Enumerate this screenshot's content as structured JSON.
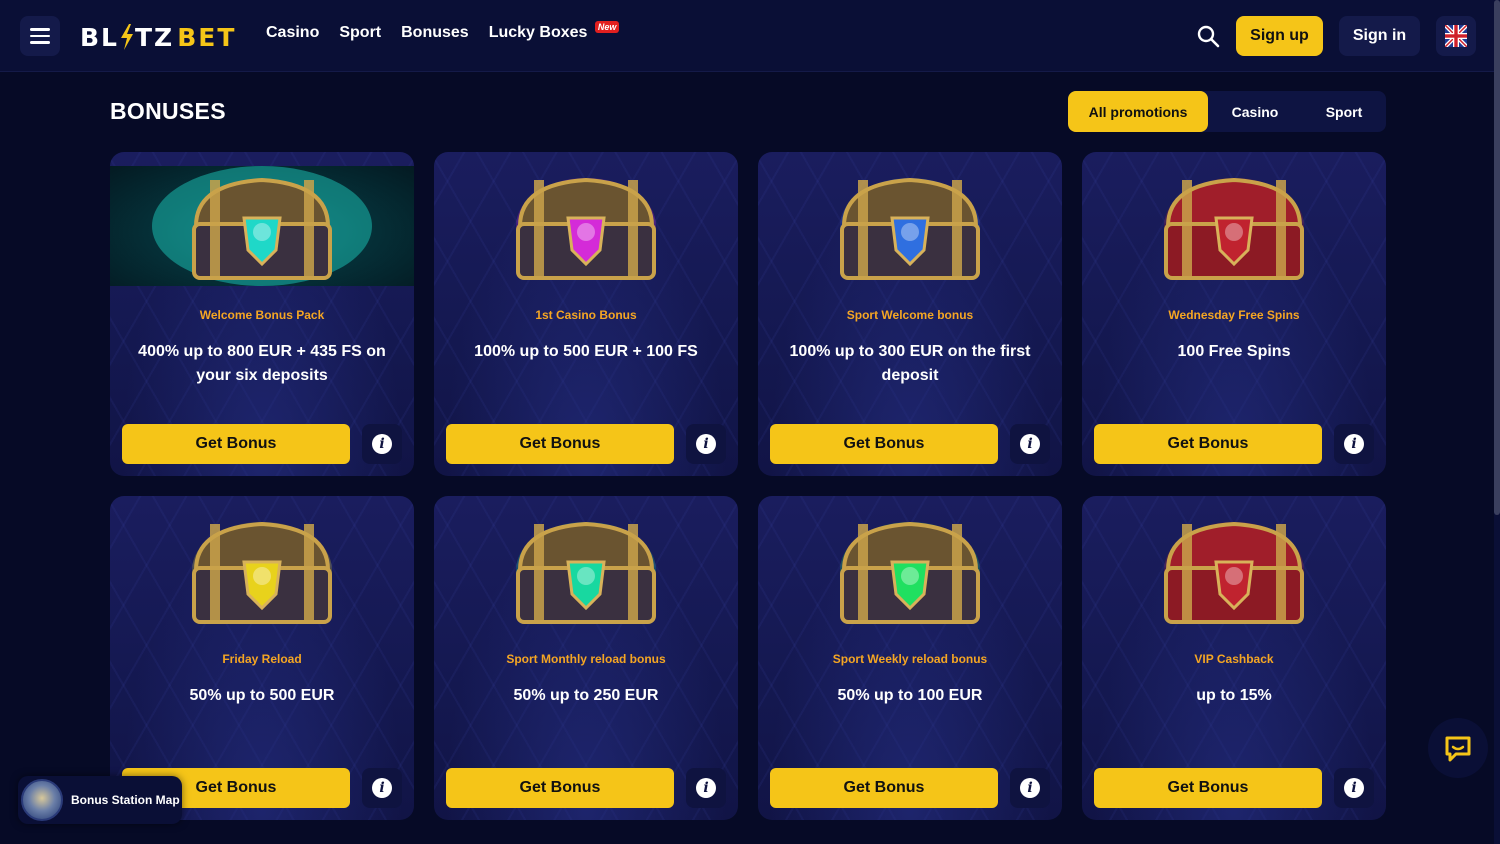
{
  "header": {
    "logo": {
      "part1": "BL",
      "part2": "TZ",
      "part3": "BET"
    },
    "nav": [
      {
        "label": "Casino"
      },
      {
        "label": "Sport"
      },
      {
        "label": "Bonuses"
      },
      {
        "label": "Lucky Boxes",
        "badge": "New"
      }
    ],
    "signup_label": "Sign up",
    "signin_label": "Sign in",
    "language": "uk-flag-icon"
  },
  "page": {
    "title": "BONUSES",
    "filters": [
      {
        "label": "All promotions",
        "active": true
      },
      {
        "label": "Casino",
        "active": false
      },
      {
        "label": "Sport",
        "active": false
      }
    ]
  },
  "cards": [
    {
      "subtitle": "Welcome Bonus Pack",
      "title": "400% up to 800 EUR + 435 FS on your six deposits",
      "button": "Get Bonus",
      "chest_color": "#1fd8c8"
    },
    {
      "subtitle": "1st Casino Bonus",
      "title": "100% up to 500 EUR + 100 FS",
      "button": "Get Bonus",
      "chest_color": "#d42bd8"
    },
    {
      "subtitle": "Sport Welcome bonus",
      "title": "100% up to 300 EUR on the first deposit",
      "button": "Get Bonus",
      "chest_color": "#2f6fe0"
    },
    {
      "subtitle": "Wednesday Free Spins",
      "title": "100 Free Spins",
      "button": "Get Bonus",
      "chest_color": "#c0232f"
    },
    {
      "subtitle": "Friday Reload",
      "title": "50% up to 500 EUR",
      "button": "Get Bonus",
      "chest_color": "#e8d21c"
    },
    {
      "subtitle": "Sport Monthly reload bonus",
      "title": "50% up to 250 EUR",
      "button": "Get Bonus",
      "chest_color": "#18d8a0"
    },
    {
      "subtitle": "Sport Weekly reload bonus",
      "title": "50% up to 100 EUR",
      "button": "Get Bonus",
      "chest_color": "#20e060"
    },
    {
      "subtitle": "VIP Cashback",
      "title": "up to 15%",
      "button": "Get Bonus",
      "chest_color": "#c0232f"
    }
  ],
  "widgets": {
    "map_label": "Bonus Station Map"
  },
  "colors": {
    "accent": "#f5c518",
    "subtitle": "#f5a623",
    "background": "#060a26"
  }
}
